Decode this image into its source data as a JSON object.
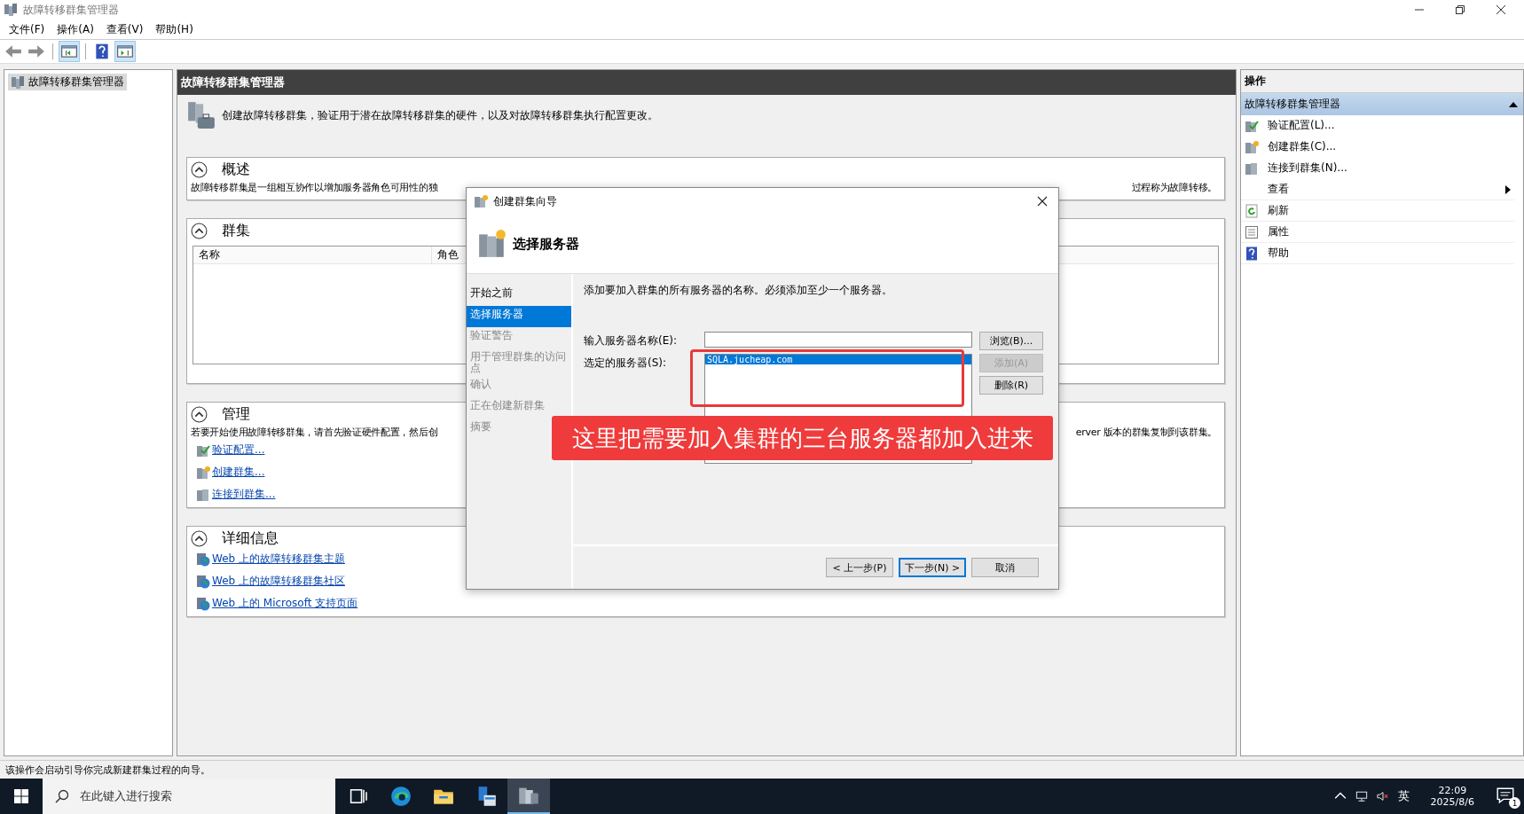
{
  "window": {
    "title": "故障转移群集管理器"
  },
  "menu": [
    "文件(F)",
    "操作(A)",
    "查看(V)",
    "帮助(H)"
  ],
  "tree": [
    {
      "label": "故障转移群集管理器",
      "selected": true
    }
  ],
  "center": {
    "header": "故障转移群集管理器",
    "intro": "创建故障转移群集，验证用于潜在故障转移群集的硬件，以及对故障转移群集执行配置更改。",
    "sections": [
      {
        "kind": "text",
        "title": "概述",
        "expanded": true,
        "text_left": "故障转移群集是一组相互协作以增加服务器角色可用性的独",
        "text_right": "过程称为故障转移。"
      },
      {
        "kind": "table",
        "title": "群集",
        "expanded": true,
        "columns": [
          "名称",
          "角色"
        ]
      },
      {
        "kind": "links",
        "title": "管理",
        "expanded": true,
        "text_left": "若要开始使用故障转移群集，请首先验证硬件配置，然后创",
        "text_right": "erver 版本的群集复制到该群集。",
        "links": [
          {
            "label": "验证配置...",
            "kind": "validate"
          },
          {
            "label": "创建群集...",
            "kind": "create"
          },
          {
            "label": "连接到群集...",
            "kind": "connect"
          }
        ]
      },
      {
        "kind": "links",
        "title": "详细信息",
        "expanded": true,
        "links": [
          {
            "label": "Web 上的故障转移群集主题",
            "kind": "web"
          },
          {
            "label": "Web 上的故障转移群集社区",
            "kind": "web"
          },
          {
            "label": "Web 上的 Microsoft 支持页面",
            "kind": "web"
          }
        ]
      }
    ]
  },
  "actions": {
    "title": "操作",
    "group": {
      "label": "故障转移群集管理器",
      "expanded": true
    },
    "items": [
      {
        "label": "验证配置(L)...",
        "kind": "validate"
      },
      {
        "label": "创建群集(C)...",
        "kind": "create"
      },
      {
        "label": "连接到群集(N)...",
        "kind": "connect"
      },
      {
        "label": "查看",
        "kind": "submenu"
      },
      {
        "label": "刷新",
        "kind": "refresh"
      },
      {
        "label": "属性",
        "kind": "properties"
      },
      {
        "label": "帮助",
        "kind": "help"
      }
    ]
  },
  "dialog": {
    "title": "创建群集向导",
    "heading": "选择服务器",
    "steps": [
      {
        "label": "开始之前",
        "selected": false,
        "disabled": false
      },
      {
        "label": "选择服务器",
        "selected": true,
        "disabled": false
      },
      {
        "label": "验证警告",
        "selected": false,
        "disabled": true
      },
      {
        "label": "用于管理群集的访问点",
        "selected": false,
        "disabled": true
      },
      {
        "label": "确认",
        "selected": false,
        "disabled": true
      },
      {
        "label": "正在创建新群集",
        "selected": false,
        "disabled": true
      },
      {
        "label": "摘要",
        "selected": false,
        "disabled": true
      }
    ],
    "instruction": "添加要加入群集的所有服务器的名称。必须添加至少一个服务器。",
    "server_name_label": "输入服务器名称(E):",
    "selected_label": "选定的服务器(S):",
    "servers": [
      {
        "label": "SQLA.jucheap.com",
        "selected": true
      }
    ],
    "side_buttons": [
      {
        "label": "浏览(B)...",
        "disabled": false
      },
      {
        "label": "添加(A)",
        "disabled": true
      },
      {
        "label": "删除(R)",
        "disabled": false
      }
    ],
    "footer_buttons": [
      {
        "label": "< 上一步(P)",
        "default": false
      },
      {
        "label": "下一步(N) >",
        "default": true
      },
      {
        "label": "取消",
        "default": false
      }
    ]
  },
  "annotation": {
    "text": "这里把需要加入集群的三台服务器都加入进来"
  },
  "status_bar": "该操作会启动引导你完成新建群集过程的向导。",
  "taskbar": {
    "search_placeholder": "在此键入进行搜索",
    "apps": [
      {
        "kind": "taskview",
        "active": false
      },
      {
        "kind": "browser",
        "active": false
      },
      {
        "kind": "folder",
        "active": false
      },
      {
        "kind": "server",
        "active": false
      },
      {
        "kind": "cluster",
        "active": true
      }
    ],
    "ime": "英",
    "time": "22:09",
    "date": "2025/8/6",
    "notifications": "1"
  }
}
